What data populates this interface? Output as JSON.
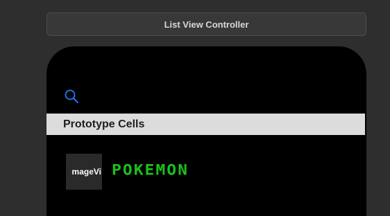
{
  "scene": {
    "title": "List View Controller"
  },
  "device": {
    "search": {
      "icon": "search-icon",
      "color": "#1a73e8"
    },
    "section_header": "Prototype Cells",
    "cell": {
      "image_text": "mageVi",
      "name": "POKEMON",
      "name_color": "#19c219"
    }
  }
}
